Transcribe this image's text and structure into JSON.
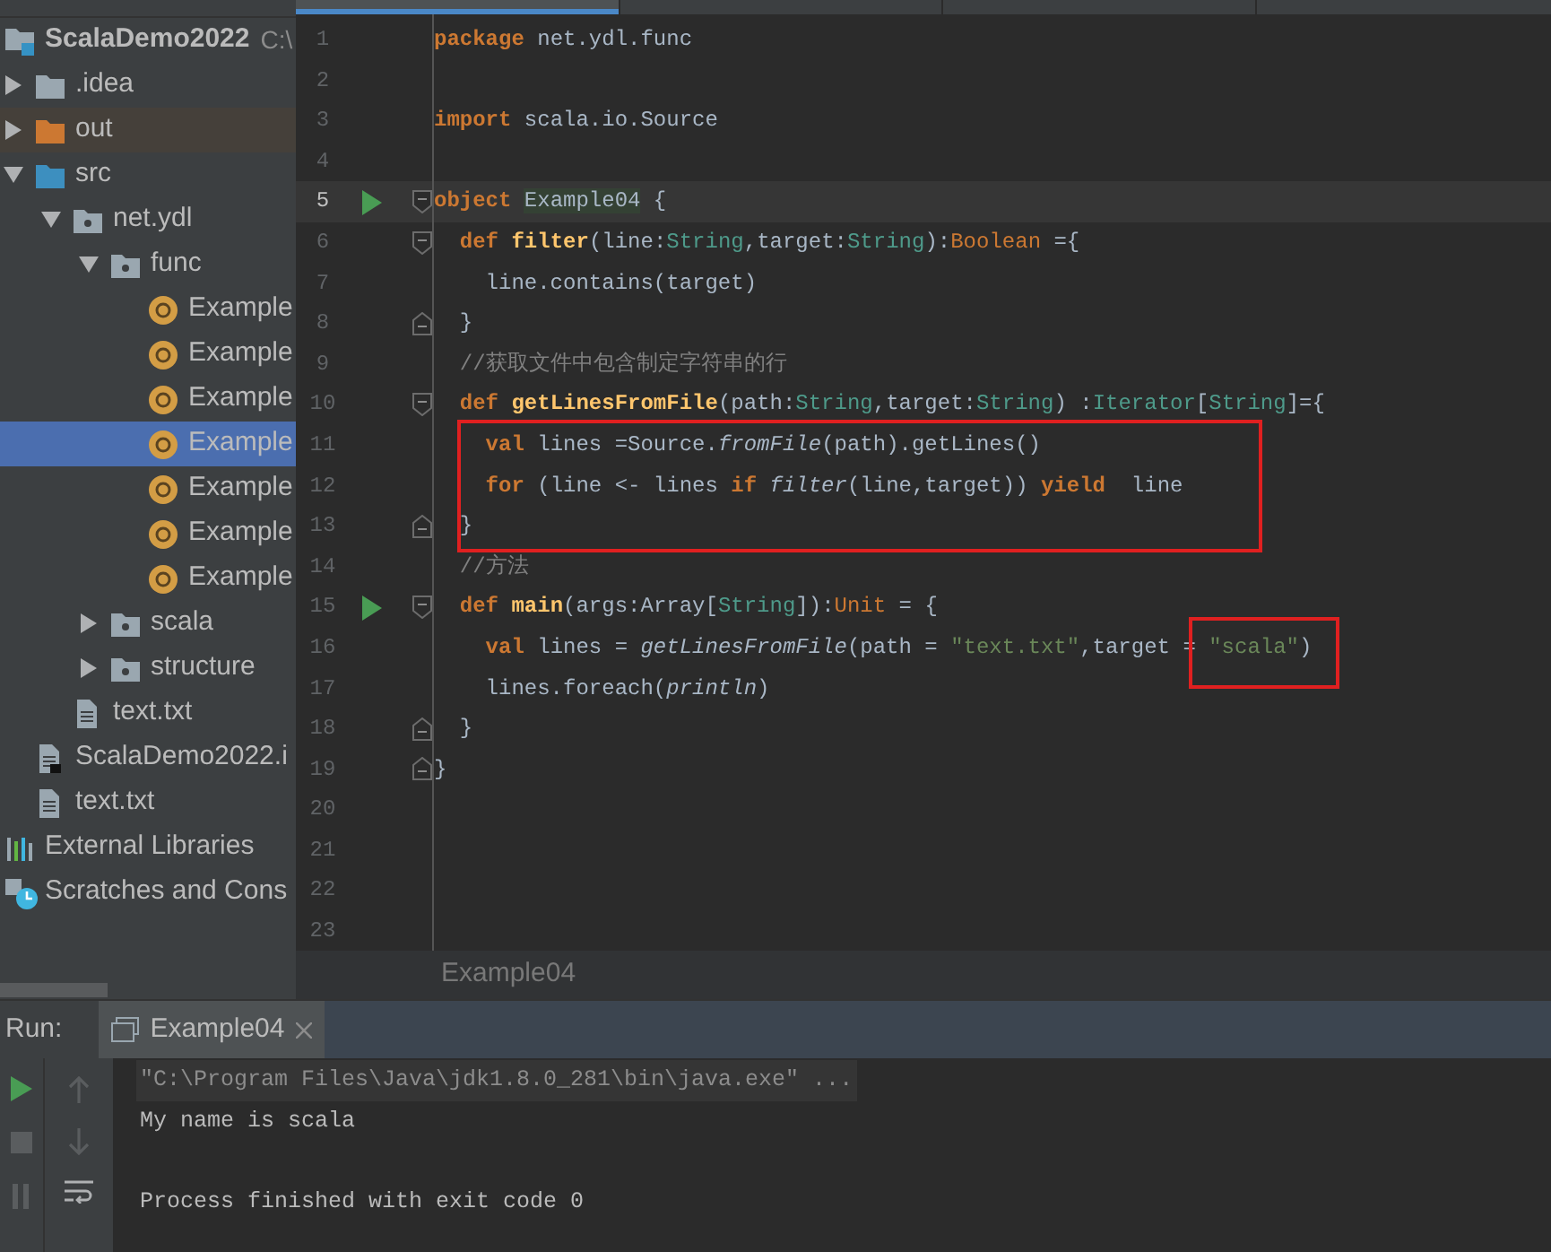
{
  "project_tree": [
    {
      "label": "ScalaDemo2022",
      "path": "C:\\",
      "kind": "project",
      "selected": false,
      "children": [
        {
          "label": ".idea",
          "kind": "folder",
          "expanded": false,
          "selected": false
        },
        {
          "label": "out",
          "kind": "excluded-folder",
          "expanded": false,
          "selected": false
        },
        {
          "label": "src",
          "kind": "source-folder",
          "expanded": true,
          "selected": false,
          "children": [
            {
              "label": "net.ydl",
              "kind": "package",
              "expanded": true,
              "selected": false,
              "children": [
                {
                  "label": "func",
                  "kind": "package",
                  "expanded": true,
                  "selected": false,
                  "children": [
                    {
                      "label": "Example",
                      "kind": "object",
                      "selected": false
                    },
                    {
                      "label": "Example",
                      "kind": "object",
                      "selected": false
                    },
                    {
                      "label": "Example",
                      "kind": "object",
                      "selected": false
                    },
                    {
                      "label": "Example",
                      "kind": "object",
                      "selected": true
                    },
                    {
                      "label": "Example",
                      "kind": "object",
                      "selected": false
                    },
                    {
                      "label": "Example",
                      "kind": "object",
                      "selected": false
                    },
                    {
                      "label": "Example",
                      "kind": "object",
                      "selected": false
                    }
                  ]
                },
                {
                  "label": "scala",
                  "kind": "package",
                  "expanded": false,
                  "selected": false
                },
                {
                  "label": "structure",
                  "kind": "package",
                  "expanded": false,
                  "selected": false
                }
              ]
            },
            {
              "label": "text.txt",
              "kind": "file",
              "selected": false
            }
          ]
        },
        {
          "label": "ScalaDemo2022.i",
          "kind": "module-file",
          "selected": false
        },
        {
          "label": "text.txt",
          "kind": "file",
          "selected": false
        }
      ]
    },
    {
      "label": "External Libraries",
      "kind": "libraries",
      "selected": false
    },
    {
      "label": "Scratches and Cons",
      "kind": "scratches",
      "selected": false
    }
  ],
  "editor": {
    "lines": [
      {
        "number": "1",
        "runnable": false,
        "fold_start": false,
        "fold_end": false,
        "current": false,
        "tokens": [
          {
            "kind": "keyword",
            "text": "package"
          },
          {
            "kind": "plain",
            "text": " net.ydl.func"
          }
        ]
      },
      {
        "number": "2",
        "runnable": false,
        "fold_start": false,
        "fold_end": false,
        "current": false
      },
      {
        "number": "3",
        "runnable": false,
        "fold_start": false,
        "fold_end": false,
        "current": false,
        "tokens": [
          {
            "kind": "keyword",
            "text": "import"
          },
          {
            "kind": "plain",
            "text": " scala.io.Source"
          }
        ]
      },
      {
        "number": "4",
        "runnable": false,
        "fold_start": false,
        "fold_end": false,
        "current": false
      },
      {
        "number": "5",
        "runnable": true,
        "fold_start": true,
        "fold_end": false,
        "current": true,
        "tokens": [
          {
            "kind": "keyword",
            "text": "object "
          },
          {
            "kind": "usage",
            "text": "Example04"
          },
          {
            "kind": "plain",
            "text": " {"
          }
        ]
      },
      {
        "number": "6",
        "runnable": false,
        "fold_start": true,
        "fold_end": false,
        "current": false,
        "tokens": [
          {
            "kind": "keyword",
            "text": "  def "
          },
          {
            "kind": "funcdef",
            "text": "filter"
          },
          {
            "kind": "plain",
            "text": "(line:"
          },
          {
            "kind": "type",
            "text": "String"
          },
          {
            "kind": "plain",
            "text": ",target:"
          },
          {
            "kind": "type",
            "text": "String"
          },
          {
            "kind": "plain",
            "text": "):"
          },
          {
            "kind": "builtin",
            "text": "Boolean"
          },
          {
            "kind": "plain",
            "text": " ={"
          }
        ]
      },
      {
        "number": "7",
        "runnable": false,
        "fold_start": false,
        "fold_end": false,
        "current": false,
        "tokens": [
          {
            "kind": "plain",
            "text": "    line.contains(target)"
          }
        ]
      },
      {
        "number": "8",
        "runnable": false,
        "fold_start": false,
        "fold_end": true,
        "current": false,
        "tokens": [
          {
            "kind": "plain",
            "text": "  }"
          }
        ]
      },
      {
        "number": "9",
        "runnable": false,
        "fold_start": false,
        "fold_end": false,
        "current": false,
        "tokens": [
          {
            "kind": "comment",
            "text": "  //获取文件中包含制定字符串的行"
          }
        ]
      },
      {
        "number": "10",
        "runnable": false,
        "fold_start": true,
        "fold_end": false,
        "current": false,
        "tokens": [
          {
            "kind": "keyword",
            "text": "  def "
          },
          {
            "kind": "funcdef",
            "text": "getLinesFromFile"
          },
          {
            "kind": "plain",
            "text": "(path:"
          },
          {
            "kind": "type",
            "text": "String"
          },
          {
            "kind": "plain",
            "text": ",target:"
          },
          {
            "kind": "type",
            "text": "String"
          },
          {
            "kind": "plain",
            "text": ") :"
          },
          {
            "kind": "type",
            "text": "Iterator"
          },
          {
            "kind": "plain",
            "text": "["
          },
          {
            "kind": "type",
            "text": "String"
          },
          {
            "kind": "plain",
            "text": "]={"
          }
        ]
      },
      {
        "number": "11",
        "runnable": false,
        "fold_start": false,
        "fold_end": false,
        "current": false,
        "tokens": [
          {
            "kind": "keyword",
            "text": "    val"
          },
          {
            "kind": "plain",
            "text": " lines =Source."
          },
          {
            "kind": "call",
            "text": "fromFile"
          },
          {
            "kind": "plain",
            "text": "(path).getLines()"
          }
        ]
      },
      {
        "number": "12",
        "runnable": false,
        "fold_start": false,
        "fold_end": false,
        "current": false,
        "tokens": [
          {
            "kind": "keyword",
            "text": "    for"
          },
          {
            "kind": "plain",
            "text": " (line <- lines "
          },
          {
            "kind": "keyword",
            "text": "if "
          },
          {
            "kind": "call",
            "text": "filter"
          },
          {
            "kind": "plain",
            "text": "(line,target)) "
          },
          {
            "kind": "keyword",
            "text": "yield"
          },
          {
            "kind": "plain",
            "text": "  line"
          }
        ]
      },
      {
        "number": "13",
        "runnable": false,
        "fold_start": false,
        "fold_end": true,
        "current": false,
        "tokens": [
          {
            "kind": "plain",
            "text": "  }"
          }
        ]
      },
      {
        "number": "14",
        "runnable": false,
        "fold_start": false,
        "fold_end": false,
        "current": false,
        "tokens": [
          {
            "kind": "comment",
            "text": "  //方法"
          }
        ]
      },
      {
        "number": "15",
        "runnable": true,
        "fold_start": true,
        "fold_end": false,
        "current": false,
        "tokens": [
          {
            "kind": "keyword",
            "text": "  def "
          },
          {
            "kind": "funcdef",
            "text": "main"
          },
          {
            "kind": "plain",
            "text": "(args:Array["
          },
          {
            "kind": "type",
            "text": "String"
          },
          {
            "kind": "plain",
            "text": "]):"
          },
          {
            "kind": "builtin",
            "text": "Unit"
          },
          {
            "kind": "plain",
            "text": " = {"
          }
        ]
      },
      {
        "number": "16",
        "runnable": false,
        "fold_start": false,
        "fold_end": false,
        "current": false,
        "tokens": [
          {
            "kind": "keyword",
            "text": "    val"
          },
          {
            "kind": "plain",
            "text": " lines = "
          },
          {
            "kind": "call",
            "text": "getLinesFromFile"
          },
          {
            "kind": "plain",
            "text": "(path = "
          },
          {
            "kind": "string",
            "text": "\"text.txt\""
          },
          {
            "kind": "plain",
            "text": ",target = "
          },
          {
            "kind": "string",
            "text": "\"scala\""
          },
          {
            "kind": "plain",
            "text": ")"
          }
        ]
      },
      {
        "number": "17",
        "runnable": false,
        "fold_start": false,
        "fold_end": false,
        "current": false,
        "tokens": [
          {
            "kind": "plain",
            "text": "    lines.foreach("
          },
          {
            "kind": "call",
            "text": "println"
          },
          {
            "kind": "plain",
            "text": ")"
          }
        ]
      },
      {
        "number": "18",
        "runnable": false,
        "fold_start": false,
        "fold_end": true,
        "current": false,
        "tokens": [
          {
            "kind": "plain",
            "text": "  }"
          }
        ]
      },
      {
        "number": "19",
        "runnable": false,
        "fold_start": false,
        "fold_end": true,
        "current": false,
        "tokens": [
          {
            "kind": "plain",
            "text": "}"
          }
        ]
      },
      {
        "number": "20",
        "runnable": false,
        "fold_start": false,
        "fold_end": false,
        "current": false
      },
      {
        "number": "21",
        "runnable": false,
        "fold_start": false,
        "fold_end": false,
        "current": false
      },
      {
        "number": "22",
        "runnable": false,
        "fold_start": false,
        "fold_end": false,
        "current": false
      },
      {
        "number": "23",
        "runnable": false,
        "fold_start": false,
        "fold_end": false,
        "current": false
      }
    ],
    "breadcrumb": "Example04"
  },
  "run_panel": {
    "label": "Run:",
    "tabs": [
      {
        "title": "Example04",
        "selected": true
      }
    ],
    "output": [
      {
        "kind": "command",
        "text": "\"C:\\Program Files\\Java\\jdk1.8.0_281\\bin\\java.exe\" ..."
      },
      {
        "kind": "stdout",
        "text": "My name is scala"
      },
      {
        "kind": "exit",
        "text": "Process finished with exit code 0"
      }
    ]
  }
}
